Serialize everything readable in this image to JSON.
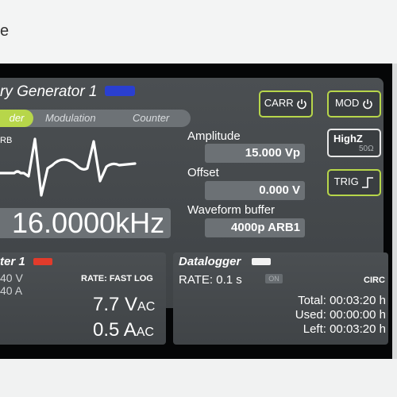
{
  "outer": {
    "fragment": "e"
  },
  "generator": {
    "title": "ry Generator 1",
    "led_color": "#2a3fd0",
    "tabs": [
      {
        "label": "der",
        "active": true
      },
      {
        "label": "Modulation",
        "active": false
      },
      {
        "label": "Counter",
        "active": false
      }
    ],
    "waveform_tag": "RB",
    "frequency": "16.0000kHz",
    "amplitude_label": "Amplitude",
    "amplitude_value": "15.000 Vp",
    "offset_label": "Offset",
    "offset_value": "0.000 V",
    "buffer_label": "Waveform buffer",
    "buffer_value": "4000p ARB1"
  },
  "buttons": {
    "carr": "CARR",
    "mod": "MOD",
    "highz": "HighZ",
    "highz_sub": "50Ω",
    "trig": "TRIG"
  },
  "meter": {
    "title": "ter 1",
    "led_color": "#e23b2b",
    "line1": "40 V",
    "line2": "40 A",
    "rate": "RATE: FAST LOG",
    "vac_value": "7.7 V",
    "vac_unit": "AC",
    "aac_value": "0.5 A",
    "aac_unit": "AC"
  },
  "datalogger": {
    "title": "Datalogger",
    "led_color": "#f2f2f2",
    "rate": "RATE: 0.1 s",
    "on_badge": "ON",
    "mode": "CIRC",
    "total": "Total: 00:03:20 h",
    "used": "Used: 00:00:00 h",
    "left": "Left: 00:03:20 h"
  },
  "colors": {
    "accent": "#b7d64a",
    "panel": "#46494c",
    "field": "#6c7175"
  }
}
